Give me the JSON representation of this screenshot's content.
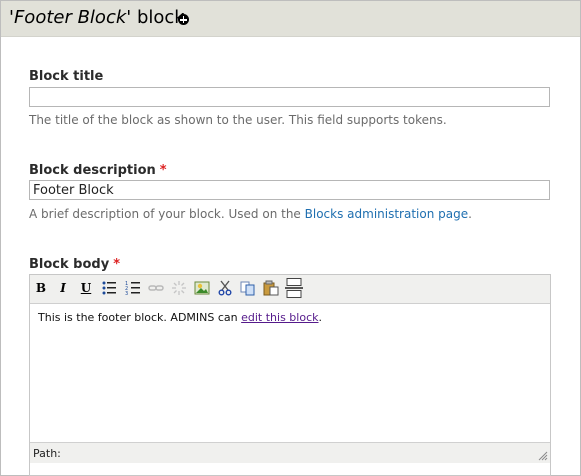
{
  "header": {
    "title_prefix": "'",
    "title_italic": "Footer Block",
    "title_suffix": "' block"
  },
  "block_title": {
    "label": "Block title",
    "value": "",
    "description": "The title of the block as shown to the user. This field supports tokens."
  },
  "block_description": {
    "label": "Block description",
    "required_mark": "*",
    "value": "Footer Block",
    "description_prefix": "A brief description of your block. Used on the ",
    "link_text": "Blocks administration page",
    "description_suffix": "."
  },
  "block_body": {
    "label": "Block body",
    "required_mark": "*",
    "toolbar": {
      "bold": "B",
      "italic": "I",
      "underline": "U"
    },
    "content_prefix": "This is the footer block.  ADMINS can ",
    "content_link": "edit this block",
    "content_suffix": ".",
    "path_label": "Path:"
  },
  "colors": {
    "header_bg": "#e1e1d9",
    "link": "#1f6fb0",
    "required": "#dd2222",
    "toolbar_bg": "#f0f0ee"
  }
}
